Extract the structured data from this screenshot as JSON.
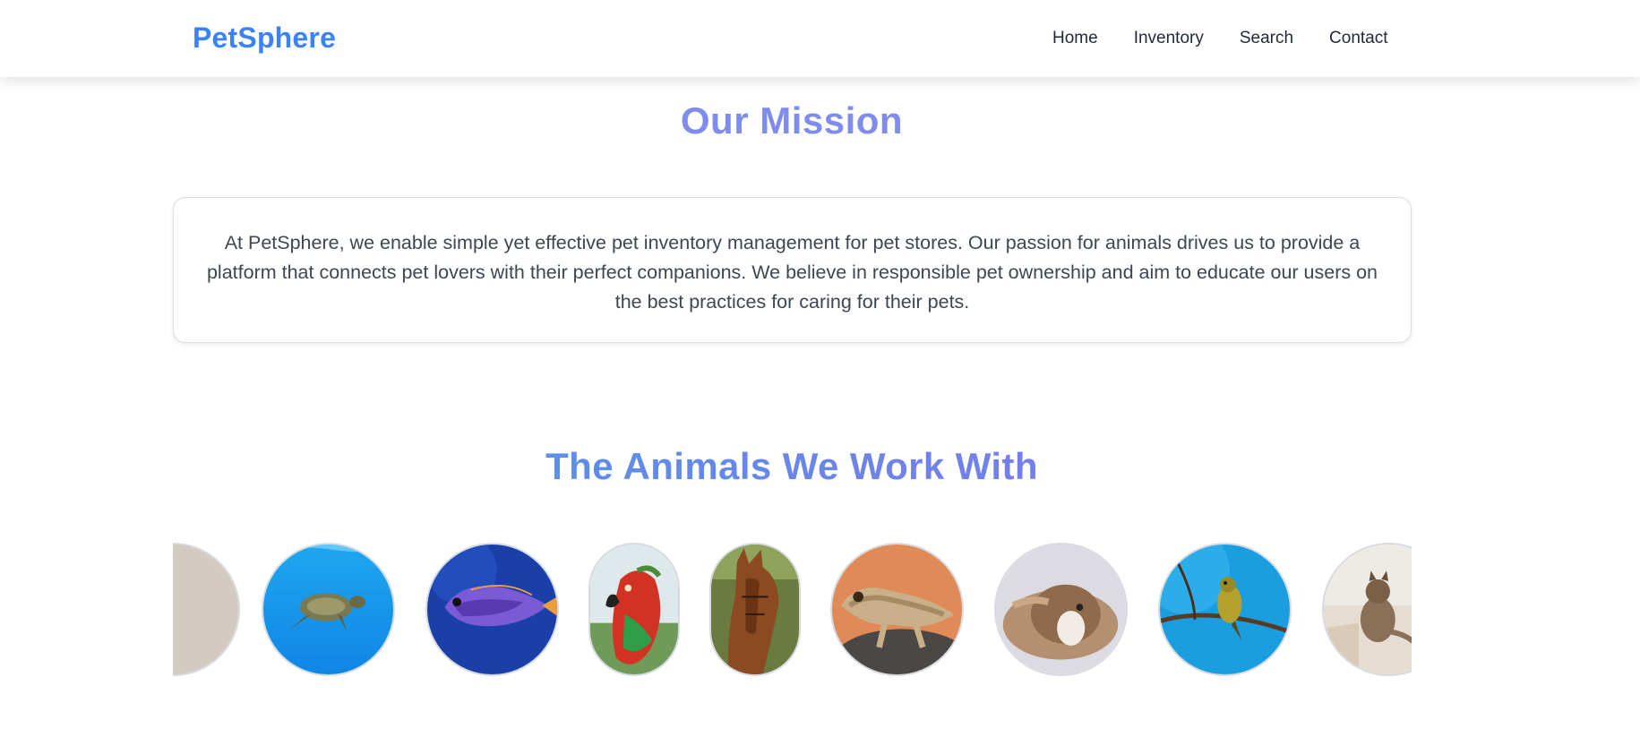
{
  "header": {
    "brand": "PetSphere",
    "nav": [
      "Home",
      "Inventory",
      "Search",
      "Contact"
    ]
  },
  "mission": {
    "title": "Our Mission",
    "text": "At PetSphere, we enable simple yet effective pet inventory management for pet stores. Our passion for animals drives us to provide a platform that connects pet lovers with their perfect companions. We believe in responsible pet ownership and aim to educate our users on the best practices for caring for their pets."
  },
  "animals": {
    "title": "The Animals We Work With",
    "items": [
      "partial-beige",
      "sea-turtle",
      "tang-fish",
      "macaw-parrot",
      "horse",
      "gecko",
      "guinea-pig",
      "songbird",
      "cat"
    ]
  },
  "colors": {
    "brand": "#3b82f6",
    "mission_title": "#7f8cec",
    "gradient_start": "#5d8ee8",
    "gradient_end": "#8f6df0"
  }
}
